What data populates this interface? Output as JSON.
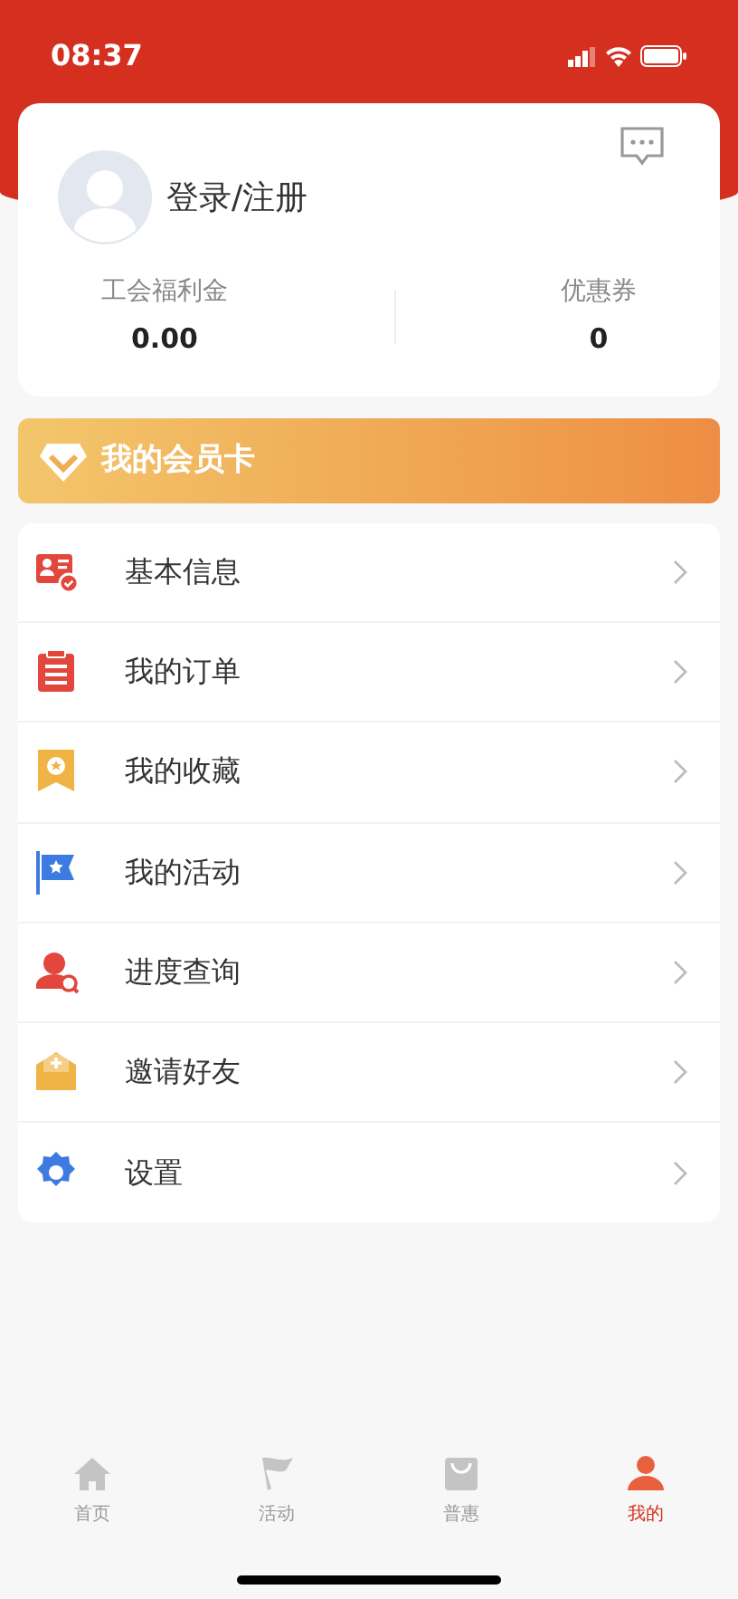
{
  "status_bar": {
    "time": "08:37"
  },
  "profile": {
    "login_label": "登录/注册",
    "stats": [
      {
        "label": "工会福利金",
        "value": "0.00"
      },
      {
        "label": "优惠券",
        "value": "0"
      }
    ]
  },
  "member_card": {
    "title": "我的会员卡"
  },
  "menu": [
    {
      "label": "基本信息"
    },
    {
      "label": "我的订单"
    },
    {
      "label": "我的收藏"
    },
    {
      "label": "我的活动"
    },
    {
      "label": "进度查询"
    },
    {
      "label": "邀请好友"
    },
    {
      "label": "设置"
    }
  ],
  "tab_bar": [
    {
      "label": "首页",
      "selected": false
    },
    {
      "label": "活动",
      "selected": false
    },
    {
      "label": "普惠",
      "selected": false
    },
    {
      "label": "我的",
      "selected": true
    }
  ]
}
